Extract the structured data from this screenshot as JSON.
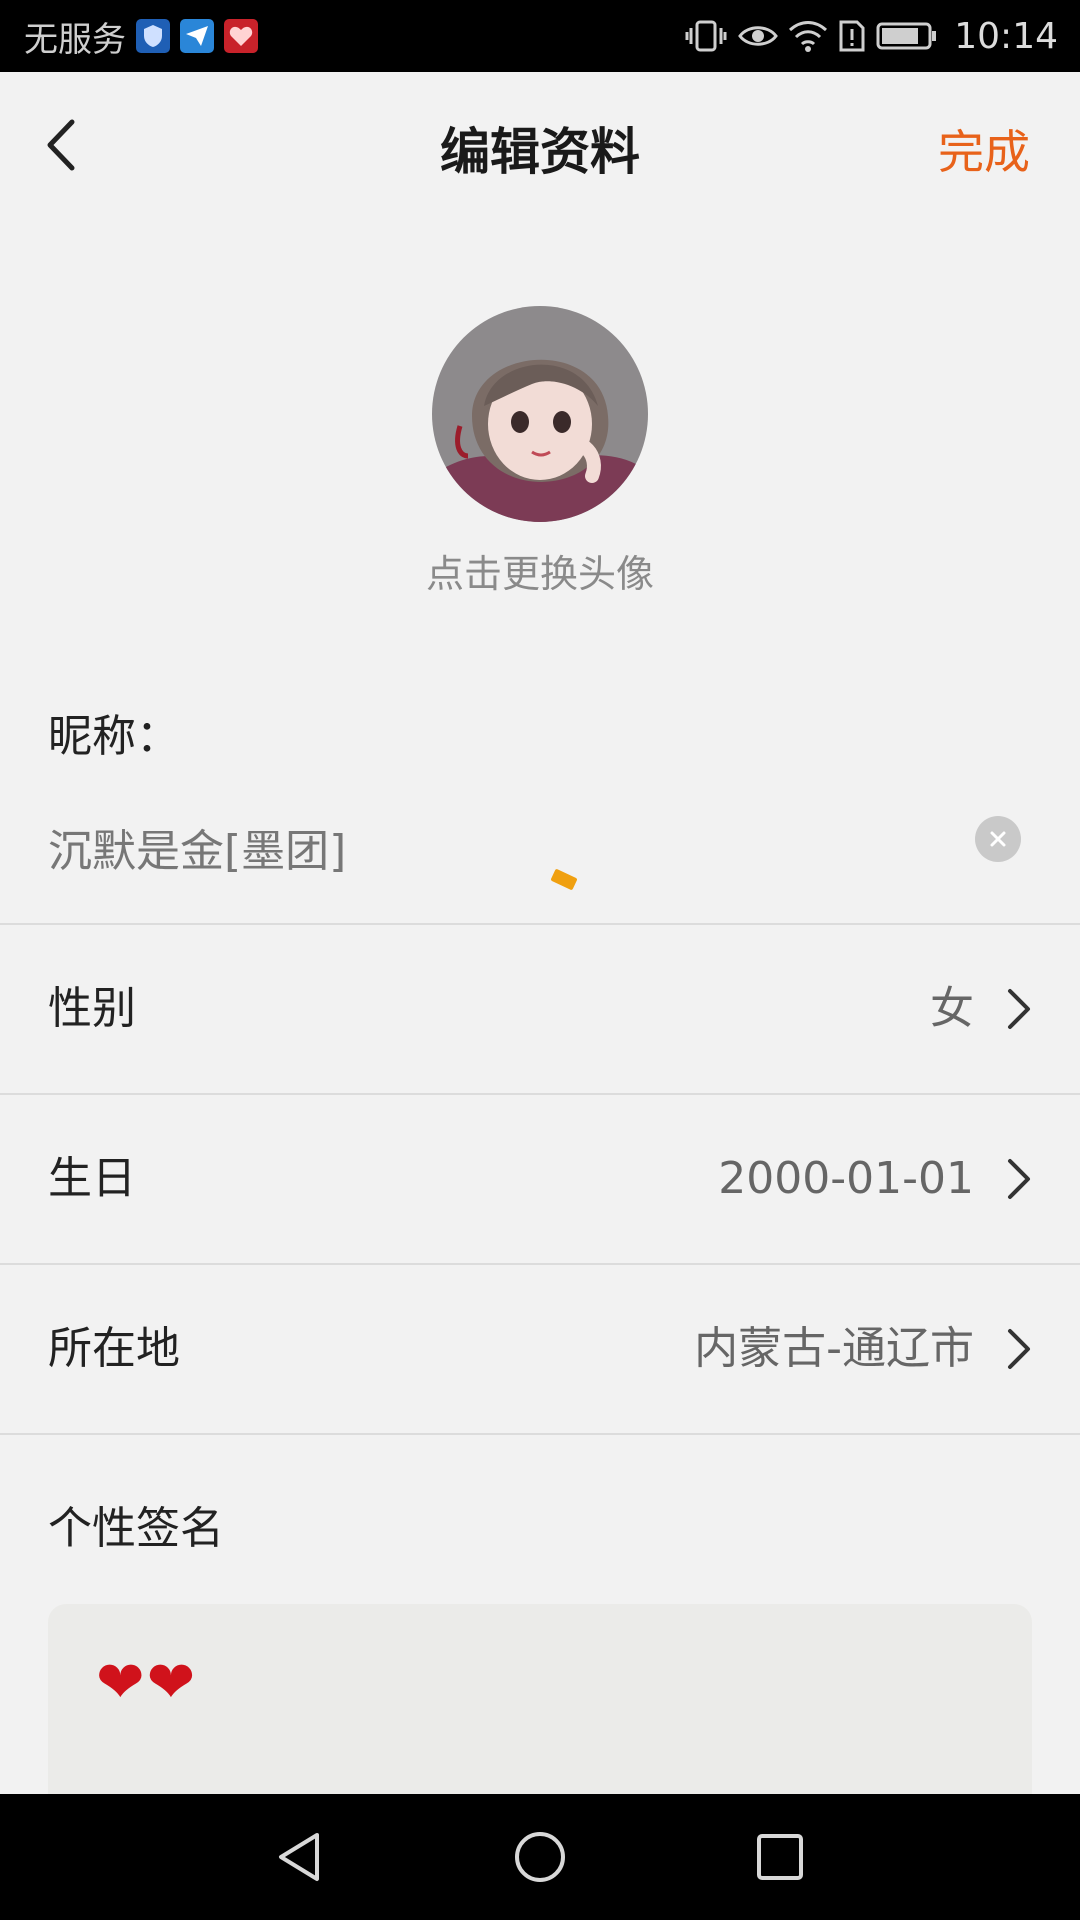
{
  "status_bar": {
    "carrier": "无服务",
    "time": "10:14",
    "icons": [
      "shield-app-icon",
      "paper-plane-app-icon",
      "heart-app-icon",
      "vibrate-icon",
      "eye-icon",
      "wifi-icon",
      "alert-sim-icon",
      "battery-icon"
    ]
  },
  "header": {
    "title": "编辑资料",
    "done_label": "完成",
    "back_icon": "chevron-left-icon"
  },
  "avatar": {
    "hint": "点击更换头像"
  },
  "nickname": {
    "label": "昵称：",
    "value": "沉默是金[墨团]"
  },
  "rows": [
    {
      "label": "性别",
      "value": "女"
    },
    {
      "label": "生日",
      "value": "2000-01-01"
    },
    {
      "label": "所在地",
      "value": "内蒙古-通辽市"
    }
  ],
  "signature": {
    "label": "个性签名",
    "value": "❤❤"
  },
  "colors": {
    "accent": "#e8621a",
    "background": "#f2f2f2",
    "heart": "#d0121b"
  }
}
